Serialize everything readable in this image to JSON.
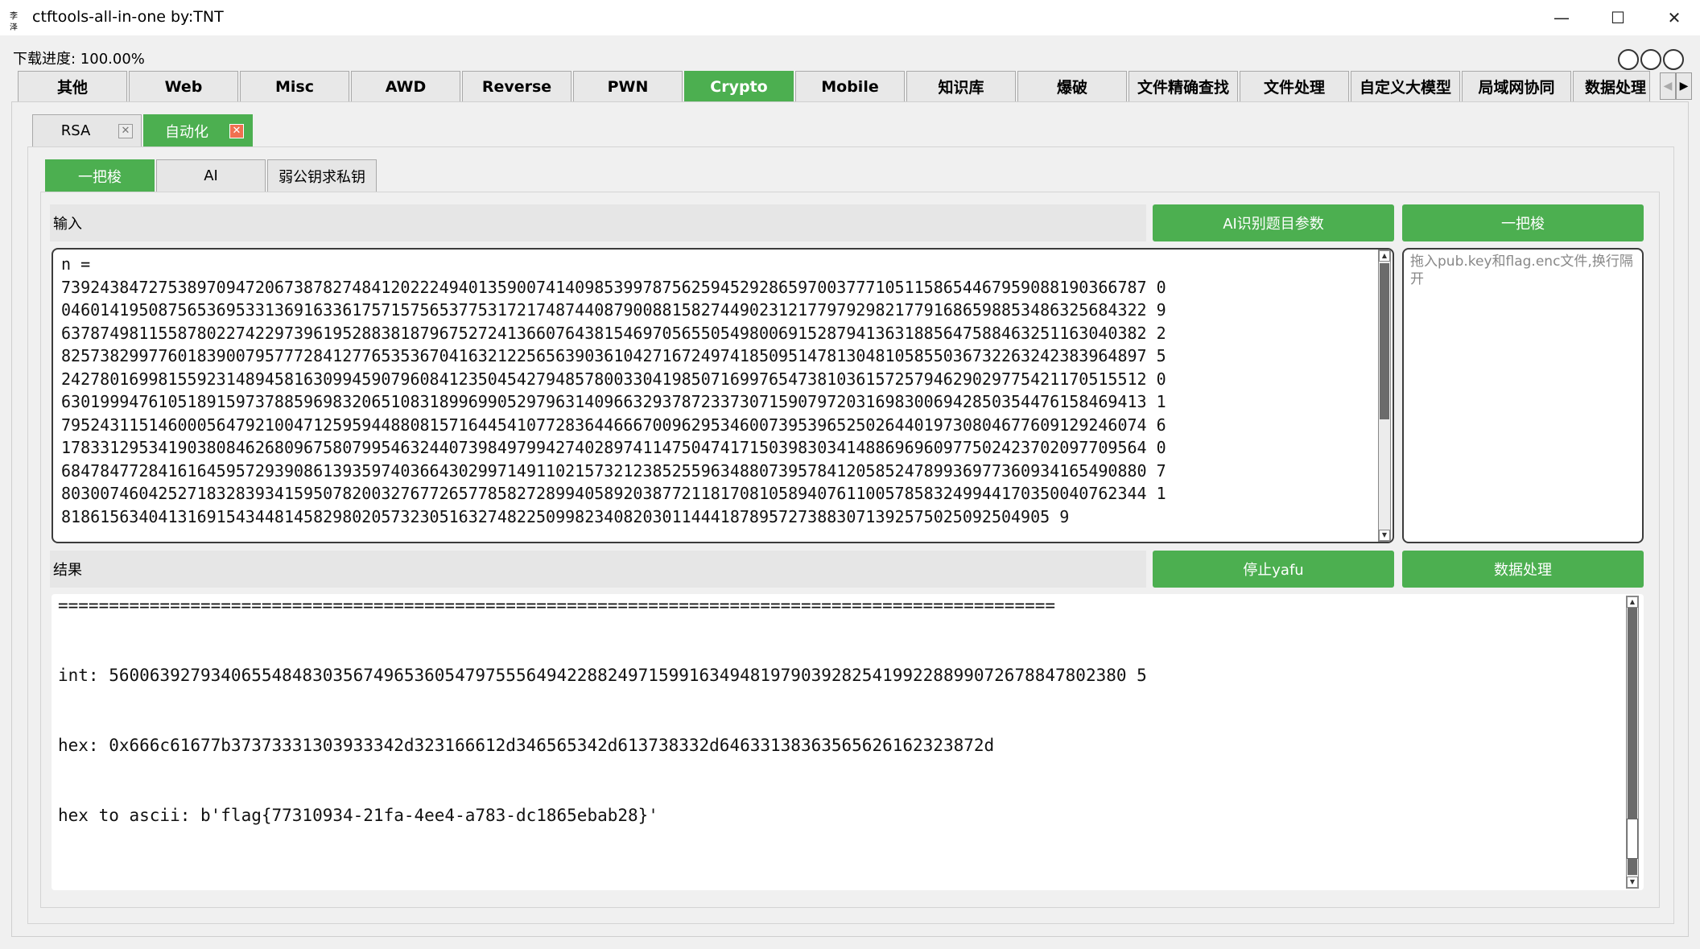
{
  "window": {
    "icon_label": "李泽",
    "title": "ctftools-all-in-one   by:TNT",
    "minimize_glyph": "—",
    "maximize_glyph": "☐",
    "close_glyph": "✕"
  },
  "download_progress": "下载进度: 100.00%",
  "main_tabs": [
    "其他",
    "Web",
    "Misc",
    "AWD",
    "Reverse",
    "PWN",
    "Crypto",
    "Mobile",
    "知识库",
    "爆破",
    "文件精确查找",
    "文件处理",
    "自定义大模型",
    "局域网协同",
    "数据处理"
  ],
  "main_tabs_active": "Crypto",
  "tab_scroll": {
    "left": "◀",
    "right": "▶"
  },
  "sub_tabs": [
    {
      "label": "RSA",
      "close": "✕"
    },
    {
      "label": "自动化",
      "close": "✕"
    }
  ],
  "tool_tabs": [
    "一把梭",
    "AI",
    "弱公钥求私钥"
  ],
  "input_section": {
    "label": "输入",
    "ai_button": "AI识别题目参数",
    "run_button": "一把梭",
    "lines": [
      "n =",
      "7392438472753897094720673878274841202224940135900741409853997875625945292865970037771051158654467959088190366787 0",
      "0460141950875653695331369163361757157565377531721748744087900881582744902312177979298217791686598853486325684322 9",
      "6378749811558780227422973961952883818796752724136607643815469705655054980069152879413631885647588463251163040382 2",
      "8257382997760183900795777284127765353670416321225656390361042716724974185095147813048105855036732263242383964897 5",
      "2427801699815592314894581630994590796084123504542794857800330419850716997654738103615725794629029775421170515512 0",
      "6301999476105189159737885969832065108318996990529796314096632937872337307159079720316983006942850354476158469413 1",
      "7952431151460005647921004712595944880815716445410772836446667009629534600739539652502644019730804677609129246074 6",
      "1783312953419038084626809675807995463244073984979942740289741147504741715039830341488696960977502423702097709564 0",
      "6847847728416164595729390861393597403664302997149110215732123852559634880739578412058524789936977360934165490880 7",
      "8030074604252718328393415950782003276772657785827289940589203877211817081058940761100578583249944170350040762344 1",
      "818615634041316915434481458298020573230516327482250998234082030114441878957273883071392575025092504905 9"
    ],
    "file_drop_hint": "拖入pub.key和flag.enc文件,换行隔开"
  },
  "result_section": {
    "label": "结果",
    "stop_button": "停止yafu",
    "data_button": "数据处理",
    "lines": [
      "==================================================================================================",
      "",
      "",
      "int: 5600639279340655484830356749653605479755564942288249715991634948197903928254199228899072678847802380 5",
      "",
      "",
      "hex: 0x666c61677b37373331303933342d323166612d346565342d613738332d64633138363565626162323872d",
      "",
      "",
      "hex to ascii: b'flag{77310934-21fa-4ee4-a783-dc1865ebab28}'",
      "",
      "",
      "",
      "==================================================================================================="
    ]
  }
}
